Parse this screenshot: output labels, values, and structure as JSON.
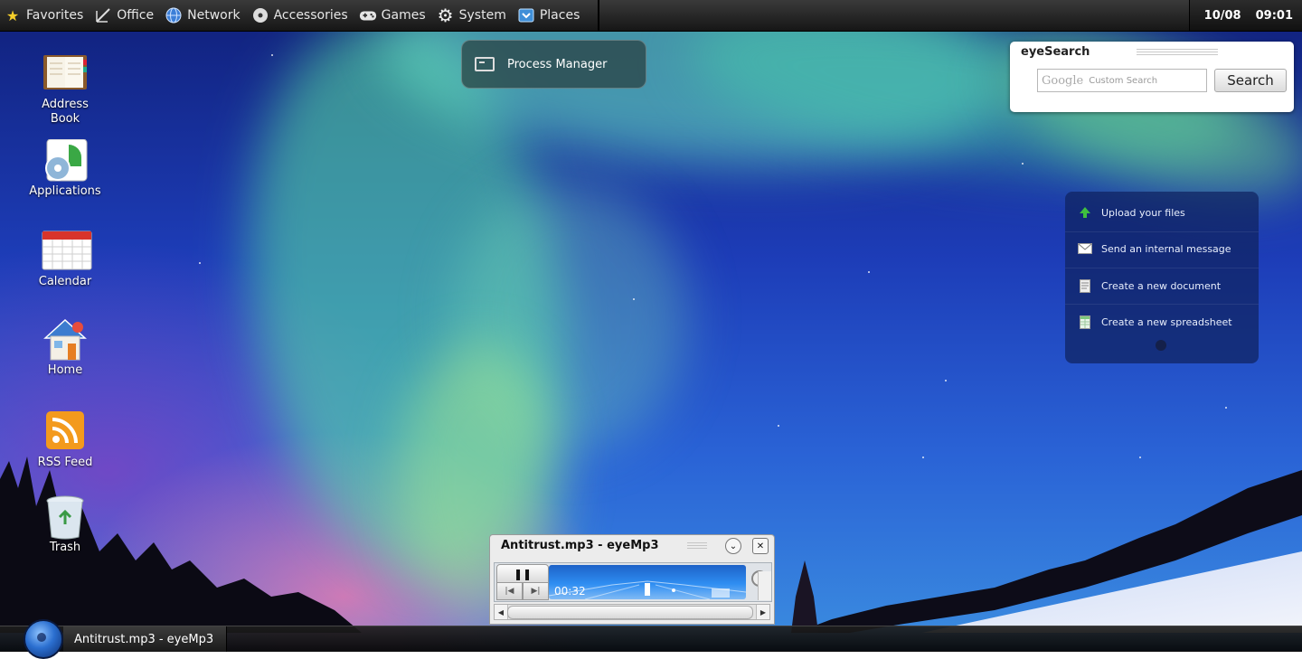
{
  "top_panel": {
    "menu": [
      {
        "label": "Favorites",
        "icon": "star-icon"
      },
      {
        "label": "Office",
        "icon": "pencil-ruler-icon"
      },
      {
        "label": "Network",
        "icon": "globe-icon"
      },
      {
        "label": "Accessories",
        "icon": "disc-icon"
      },
      {
        "label": "Games",
        "icon": "gamepad-icon"
      },
      {
        "label": "System",
        "icon": "gear-icon"
      },
      {
        "label": "Places",
        "icon": "folder-icon"
      }
    ],
    "date": "10/08",
    "time": "09:01"
  },
  "desktop_icons": [
    {
      "label": "Address Book",
      "icon": "address-book-icon"
    },
    {
      "label": "Applications",
      "icon": "applications-icon"
    },
    {
      "label": "Calendar",
      "icon": "calendar-icon"
    },
    {
      "label": "Home",
      "icon": "home-icon"
    },
    {
      "label": "RSS Feed",
      "icon": "rss-icon"
    },
    {
      "label": "Trash",
      "icon": "trash-icon"
    }
  ],
  "process_manager": {
    "label": "Process Manager",
    "icon": "monitor-icon"
  },
  "eyesearch": {
    "title": "eyeSearch",
    "google_text": "Google",
    "placeholder": "Custom Search",
    "button": "Search"
  },
  "quick_actions": [
    {
      "label": "Upload your files",
      "icon": "upload-arrow-icon",
      "color": "#3fbf3f"
    },
    {
      "label": "Send an internal message",
      "icon": "envelope-icon",
      "color": "#ffffff"
    },
    {
      "label": "Create a new document",
      "icon": "document-icon",
      "color": "#e8e8e8"
    },
    {
      "label": "Create a new spreadsheet",
      "icon": "spreadsheet-icon",
      "color": "#7ec97e"
    }
  ],
  "player": {
    "title": "Antitrust.mp3 - eyeMp3",
    "time": "00:32",
    "pause_symbol": "❚❚",
    "prev_symbol": "|◀",
    "next_symbol": "▶|"
  },
  "taskbar": {
    "items": [
      {
        "label": "Antitrust.mp3 - eyeMp3"
      }
    ]
  }
}
